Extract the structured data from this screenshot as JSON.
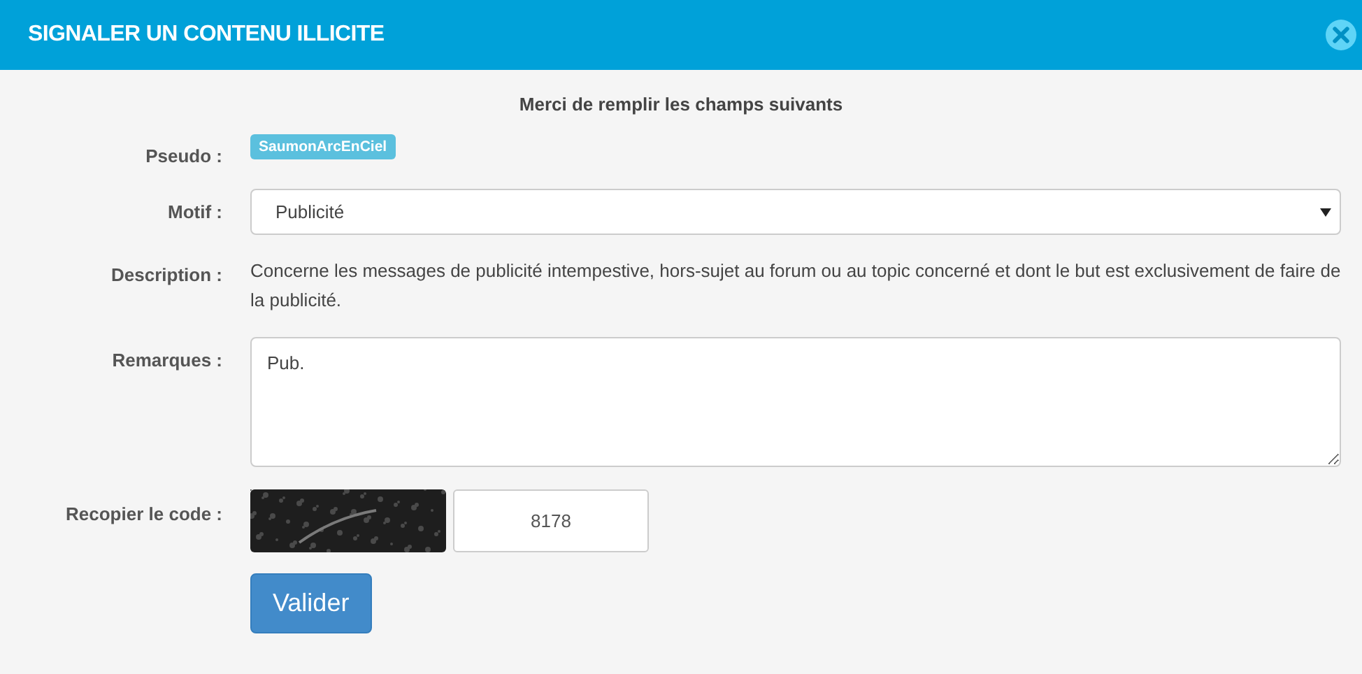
{
  "window": {
    "title": "SIGNALER UN CONTENU ILLICITE"
  },
  "intro": "Merci de remplir les champs suivants",
  "form": {
    "pseudo": {
      "label": "Pseudo :",
      "value": "SaumonArcEnCiel"
    },
    "motif": {
      "label": "Motif :",
      "value": "Publicité"
    },
    "description": {
      "label": "Description :",
      "text": "Concerne les messages de publicité intempestive, hors-sujet au forum ou au topic concerné et dont le but est exclusivement de faire de la publicité."
    },
    "remarques": {
      "label": "Remarques :",
      "value": "Pub."
    },
    "code": {
      "label": "Recopier le code :",
      "value": "8178"
    }
  },
  "buttons": [
    "Valider"
  ]
}
